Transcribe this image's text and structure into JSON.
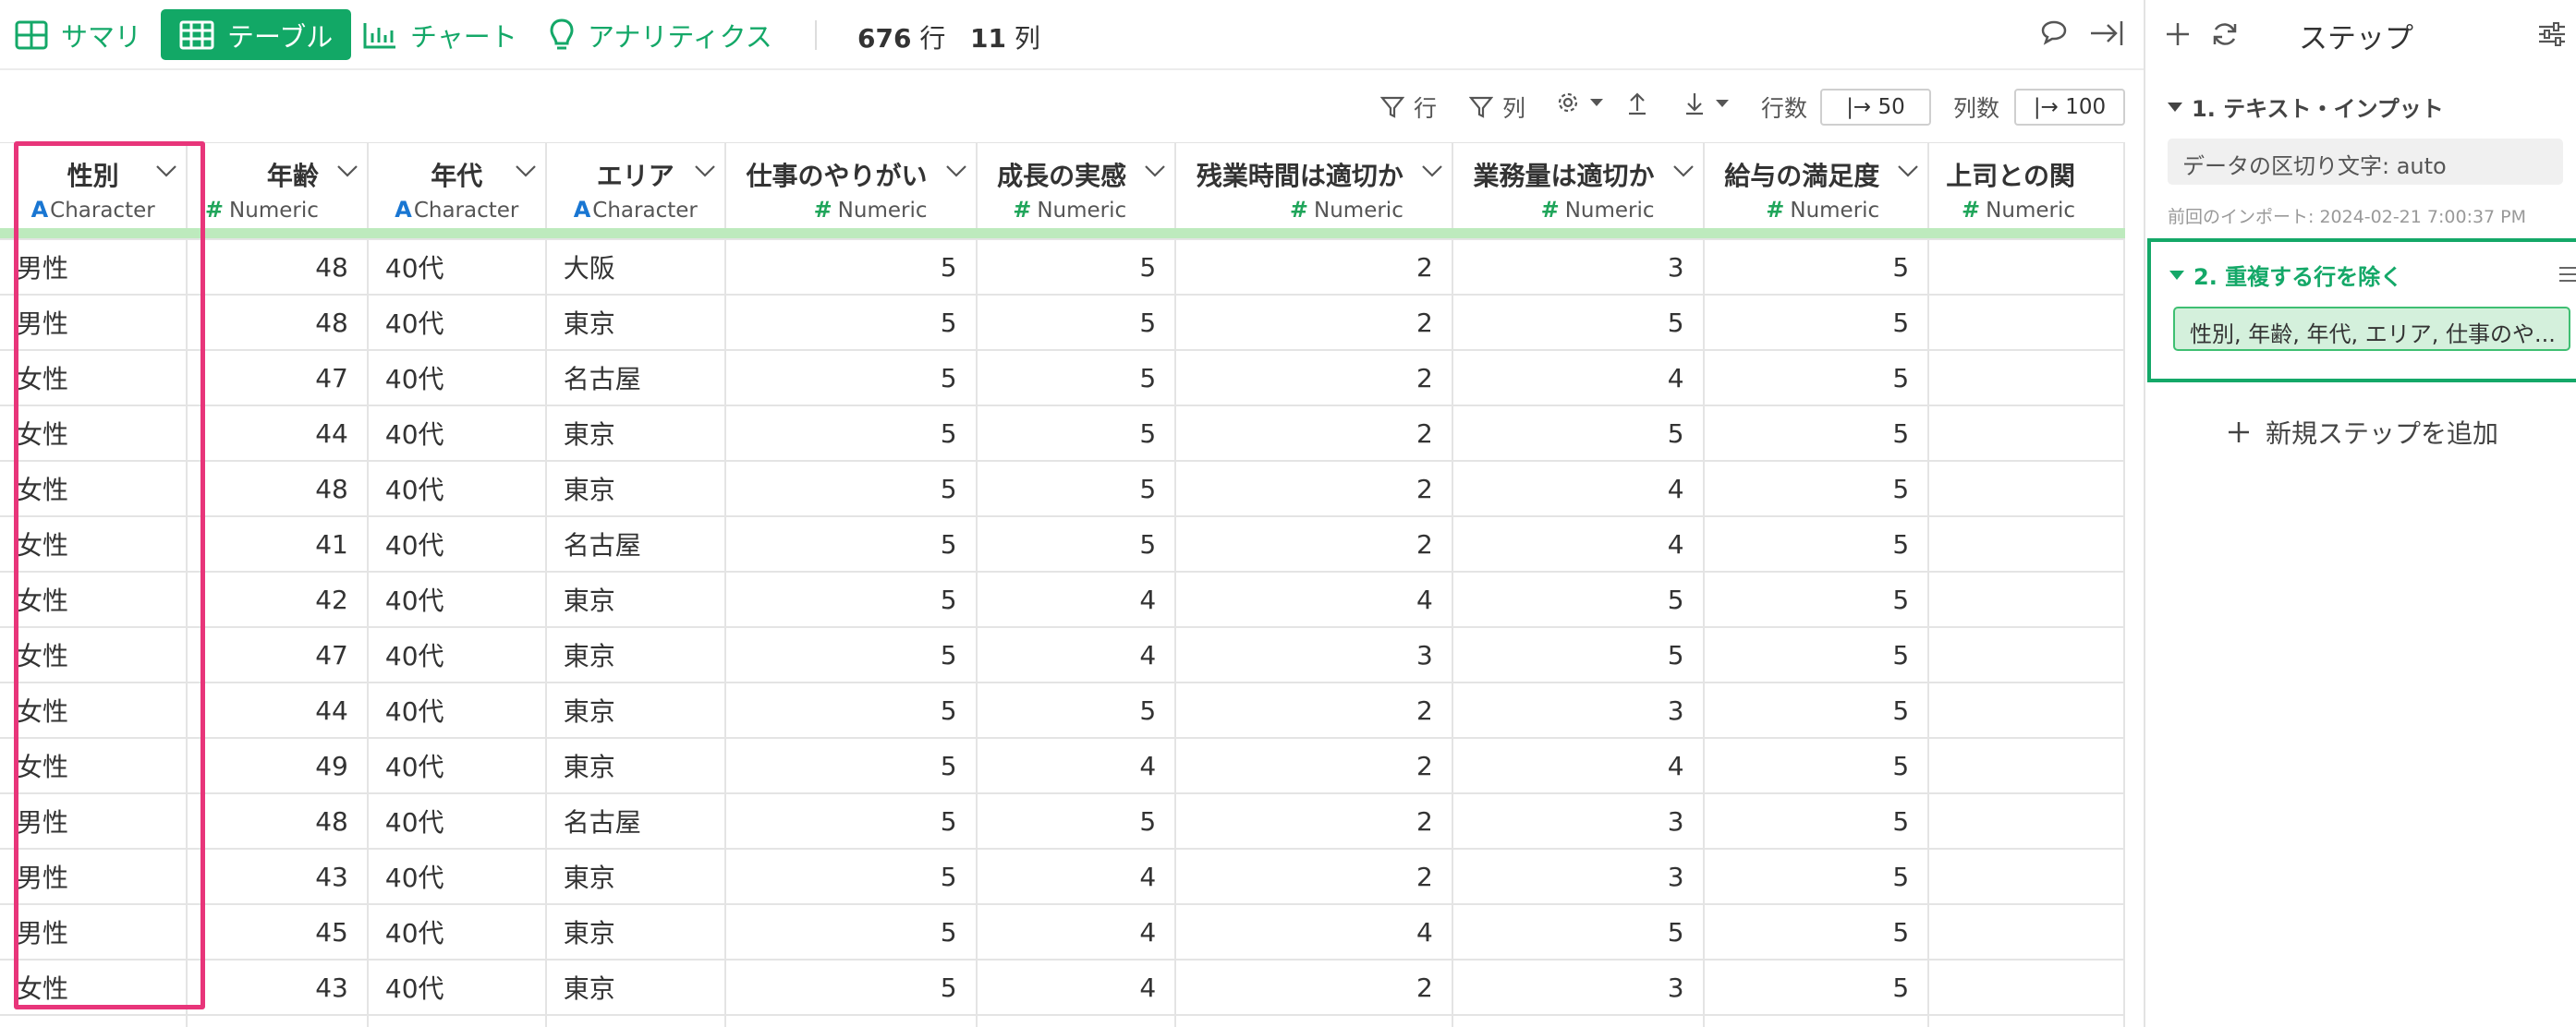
{
  "toolbar": {
    "tabs": [
      {
        "label": "サマリ",
        "icon": "summary-grid-icon",
        "active": false
      },
      {
        "label": "テーブル",
        "icon": "table-icon",
        "active": true
      },
      {
        "label": "チャート",
        "icon": "chart-icon",
        "active": false
      },
      {
        "label": "アナリティクス",
        "icon": "lightbulb-icon",
        "active": false
      }
    ],
    "rows_count": "676",
    "rows_unit": "行",
    "cols_count": "11",
    "cols_unit": "列"
  },
  "subtoolbar": {
    "row_filter_label": "行",
    "col_filter_label": "列",
    "rows_label": "行数",
    "rows_value": "|→ 50",
    "cols_label": "列数",
    "cols_value": "|→ 100"
  },
  "table": {
    "columns": [
      {
        "name": "性別",
        "type": "Character",
        "type_icon": "A"
      },
      {
        "name": "年齢",
        "type": "Numeric",
        "type_icon": "#"
      },
      {
        "name": "年代",
        "type": "Character",
        "type_icon": "A"
      },
      {
        "name": "エリア",
        "type": "Character",
        "type_icon": "A"
      },
      {
        "name": "仕事のやりがい",
        "type": "Numeric",
        "type_icon": "#"
      },
      {
        "name": "成長の実感",
        "type": "Numeric",
        "type_icon": "#"
      },
      {
        "name": "残業時間は適切か",
        "type": "Numeric",
        "type_icon": "#"
      },
      {
        "name": "業務量は適切か",
        "type": "Numeric",
        "type_icon": "#"
      },
      {
        "name": "給与の満足度",
        "type": "Numeric",
        "type_icon": "#"
      },
      {
        "name": "上司との関",
        "type": "Numeric",
        "type_icon": "#"
      }
    ],
    "rows": [
      [
        "男性",
        "48",
        "40代",
        "大阪",
        "5",
        "5",
        "2",
        "3",
        "5",
        ""
      ],
      [
        "男性",
        "48",
        "40代",
        "東京",
        "5",
        "5",
        "2",
        "5",
        "5",
        ""
      ],
      [
        "女性",
        "47",
        "40代",
        "名古屋",
        "5",
        "5",
        "2",
        "4",
        "5",
        ""
      ],
      [
        "女性",
        "44",
        "40代",
        "東京",
        "5",
        "5",
        "2",
        "5",
        "5",
        ""
      ],
      [
        "女性",
        "48",
        "40代",
        "東京",
        "5",
        "5",
        "2",
        "4",
        "5",
        ""
      ],
      [
        "女性",
        "41",
        "40代",
        "名古屋",
        "5",
        "5",
        "2",
        "4",
        "5",
        ""
      ],
      [
        "女性",
        "42",
        "40代",
        "東京",
        "5",
        "4",
        "4",
        "5",
        "5",
        ""
      ],
      [
        "女性",
        "47",
        "40代",
        "東京",
        "5",
        "4",
        "3",
        "5",
        "5",
        ""
      ],
      [
        "女性",
        "44",
        "40代",
        "東京",
        "5",
        "5",
        "2",
        "3",
        "5",
        ""
      ],
      [
        "女性",
        "49",
        "40代",
        "東京",
        "5",
        "4",
        "2",
        "4",
        "5",
        ""
      ],
      [
        "男性",
        "48",
        "40代",
        "名古屋",
        "5",
        "5",
        "2",
        "3",
        "5",
        ""
      ],
      [
        "男性",
        "43",
        "40代",
        "東京",
        "5",
        "4",
        "2",
        "3",
        "5",
        ""
      ],
      [
        "男性",
        "45",
        "40代",
        "東京",
        "5",
        "4",
        "4",
        "5",
        "5",
        ""
      ],
      [
        "女性",
        "43",
        "40代",
        "東京",
        "5",
        "4",
        "2",
        "3",
        "5",
        ""
      ],
      [
        "",
        "",
        "",
        "",
        "",
        "",
        "",
        "",
        "",
        ""
      ]
    ]
  },
  "panel": {
    "title": "ステップ",
    "step1": {
      "title": "1. テキスト・インプット",
      "detail": "データの区切り文字: auto",
      "timestamp": "前回のインポート: 2024-02-21 7:00:37 PM"
    },
    "step2": {
      "title": "2. 重複する行を除く",
      "columns": "性別, 年齢, 年代, エリア, 仕事のや..."
    },
    "add_step_label": "新規ステップを追加"
  },
  "colors": {
    "accent": "#12a866",
    "highlight": "#e8357a",
    "quality_bar": "#bdeabd"
  }
}
